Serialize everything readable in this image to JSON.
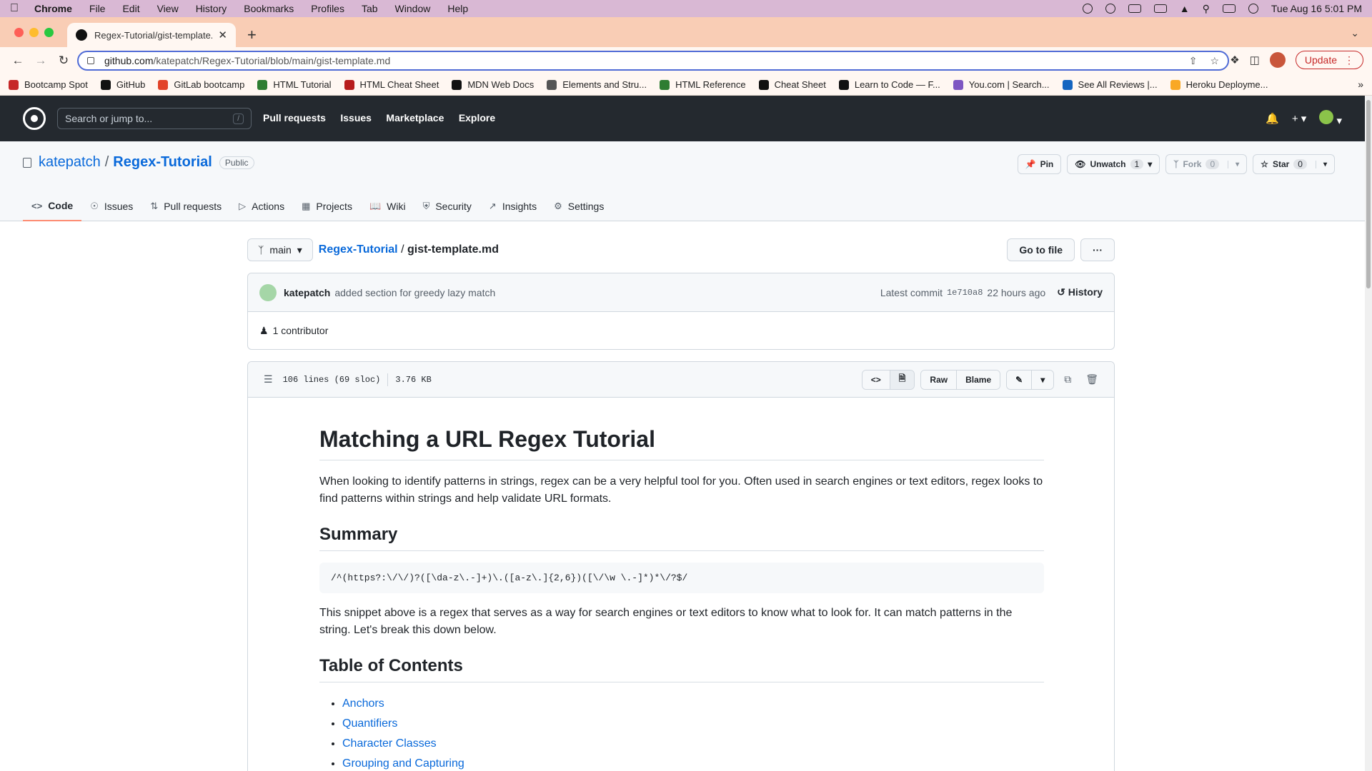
{
  "menubar": {
    "app": "Chrome",
    "items": [
      "File",
      "Edit",
      "View",
      "History",
      "Bookmarks",
      "Profiles",
      "Tab",
      "Window",
      "Help"
    ],
    "clock": "Tue Aug 16  5:01 PM"
  },
  "browser": {
    "tab_title": "Regex-Tutorial/gist-template.m",
    "url_host": "github.com",
    "url_path": "/katepatch/Regex-Tutorial/blob/main/gist-template.md",
    "update_label": "Update",
    "bookmarks": [
      {
        "label": "Bootcamp Spot",
        "color": "#c62828"
      },
      {
        "label": "GitHub",
        "color": "#111111"
      },
      {
        "label": "GitLab bootcamp",
        "color": "#e24329"
      },
      {
        "label": "HTML Tutorial",
        "color": "#2e7d32"
      },
      {
        "label": "HTML Cheat Sheet",
        "color": "#b71c1c"
      },
      {
        "label": "MDN Web Docs",
        "color": "#111111"
      },
      {
        "label": "Elements and Stru...",
        "color": "#555555"
      },
      {
        "label": "HTML Reference",
        "color": "#2e7d32"
      },
      {
        "label": "Cheat Sheet",
        "color": "#111111"
      },
      {
        "label": "Learn to Code — F...",
        "color": "#111111"
      },
      {
        "label": "You.com | Search...",
        "color": "#7e57c2"
      },
      {
        "label": "See All Reviews |...",
        "color": "#1565c0"
      },
      {
        "label": "Heroku Deployme...",
        "color": "#f9a825"
      }
    ]
  },
  "github": {
    "search_placeholder": "Search or jump to...",
    "search_shortcut": "/",
    "nav": [
      "Pull requests",
      "Issues",
      "Marketplace",
      "Explore"
    ],
    "owner": "katepatch",
    "repo": "Regex-Tutorial",
    "visibility": "Public",
    "actions": {
      "pin": "Pin",
      "unwatch": "Unwatch",
      "watch_count": "1",
      "fork": "Fork",
      "fork_count": "0",
      "star": "Star",
      "star_count": "0"
    },
    "tabs": [
      "Code",
      "Issues",
      "Pull requests",
      "Actions",
      "Projects",
      "Wiki",
      "Security",
      "Insights",
      "Settings"
    ]
  },
  "file": {
    "branch": "main",
    "repo_crumb": "Regex-Tutorial",
    "filename": "gist-template.md",
    "go_to_file": "Go to file",
    "more": "···",
    "commit": {
      "author": "katepatch",
      "message": "added section for greedy lazy match",
      "latest_label": "Latest commit",
      "sha": "1e710a8",
      "time": "22 hours ago",
      "history": "History"
    },
    "contributors": "1 contributor",
    "lines": "106 lines (69 sloc)",
    "size": "3.76 KB",
    "raw": "Raw",
    "blame": "Blame"
  },
  "markdown": {
    "h1": "Matching a URL Regex Tutorial",
    "intro": "When looking to identify patterns in strings, regex can be a very helpful tool for you. Often used in search engines or text editors, regex looks to find patterns within strings and help validate URL formats.",
    "summary_heading": "Summary",
    "code": "/^(https?:\\/\\/)?([\\da-z\\.-]+)\\.([a-z\\.]{2,6})([\\/\\w \\.-]*)*\\/?$/",
    "summary_text": "This snippet above is a regex that serves as a way for search engines or text editors to know what to look for. It can match patterns in the string. Let's break this down below.",
    "toc_heading": "Table of Contents",
    "toc": [
      "Anchors",
      "Quantifiers",
      "Character Classes",
      "Grouping and Capturing"
    ]
  }
}
